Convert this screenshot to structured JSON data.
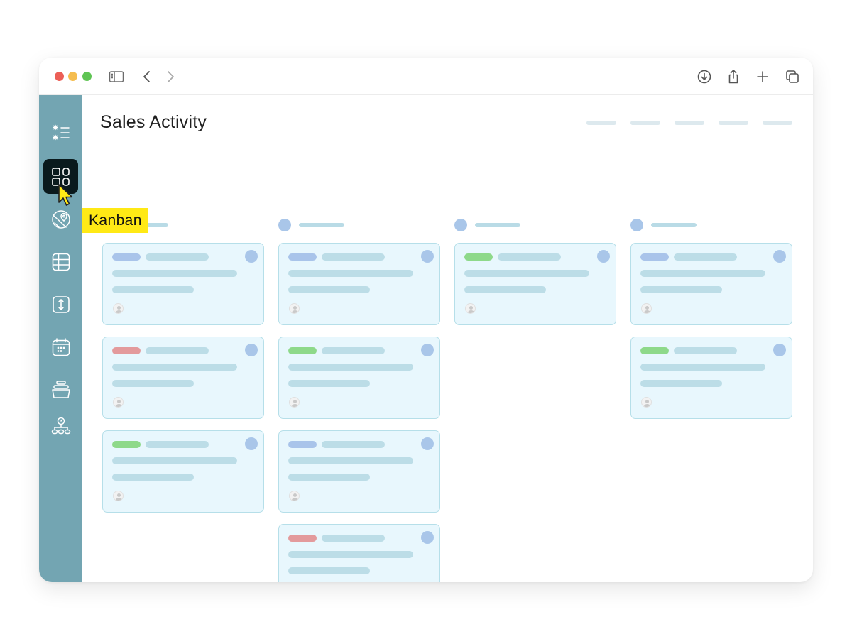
{
  "window": {
    "traffic_lights": [
      {
        "name": "close",
        "color": "#ec5f57"
      },
      {
        "name": "minimize",
        "color": "#f5bd4f"
      },
      {
        "name": "zoom",
        "color": "#5fc454"
      }
    ],
    "toolbar_left": [
      "sidebar-toggle-icon",
      "back-icon",
      "forward-icon"
    ],
    "toolbar_right": [
      "download-icon",
      "share-icon",
      "new-tab-icon",
      "tabs-overview-icon"
    ]
  },
  "sidebar": {
    "background": "#73a5b2",
    "items": [
      {
        "id": "list",
        "icon": "list-icon",
        "active": false
      },
      {
        "id": "kanban",
        "icon": "kanban-icon",
        "active": true
      },
      {
        "id": "map",
        "icon": "map-pin-icon",
        "active": false
      },
      {
        "id": "grid",
        "icon": "grid-icon",
        "active": false
      },
      {
        "id": "timeline",
        "icon": "timeline-icon",
        "active": false
      },
      {
        "id": "calendar",
        "icon": "calendar-icon",
        "active": false
      },
      {
        "id": "gallery",
        "icon": "gallery-icon",
        "active": false
      },
      {
        "id": "org",
        "icon": "org-chart-icon",
        "active": false
      }
    ]
  },
  "tooltip": {
    "label": "Kanban",
    "color": "#ffe915"
  },
  "main": {
    "title": "Sales Activity",
    "header_tab_count": 5
  },
  "colors": {
    "tag_blue": "#a9c4ea",
    "tag_red": "#e39a9c",
    "tag_green": "#8ed98a",
    "card_bg": "#e8f7fd",
    "card_border": "#b6dfe9",
    "placeholder": "#bcdde7",
    "status_dot": "#a9c6e9"
  },
  "columns": [
    {
      "cards": [
        {
          "tag": "blue"
        },
        {
          "tag": "red"
        },
        {
          "tag": "green"
        }
      ]
    },
    {
      "cards": [
        {
          "tag": "blue"
        },
        {
          "tag": "green"
        },
        {
          "tag": "blue"
        },
        {
          "tag": "red"
        }
      ]
    },
    {
      "cards": [
        {
          "tag": "green"
        }
      ]
    },
    {
      "cards": [
        {
          "tag": "blue"
        },
        {
          "tag": "green"
        }
      ]
    }
  ]
}
